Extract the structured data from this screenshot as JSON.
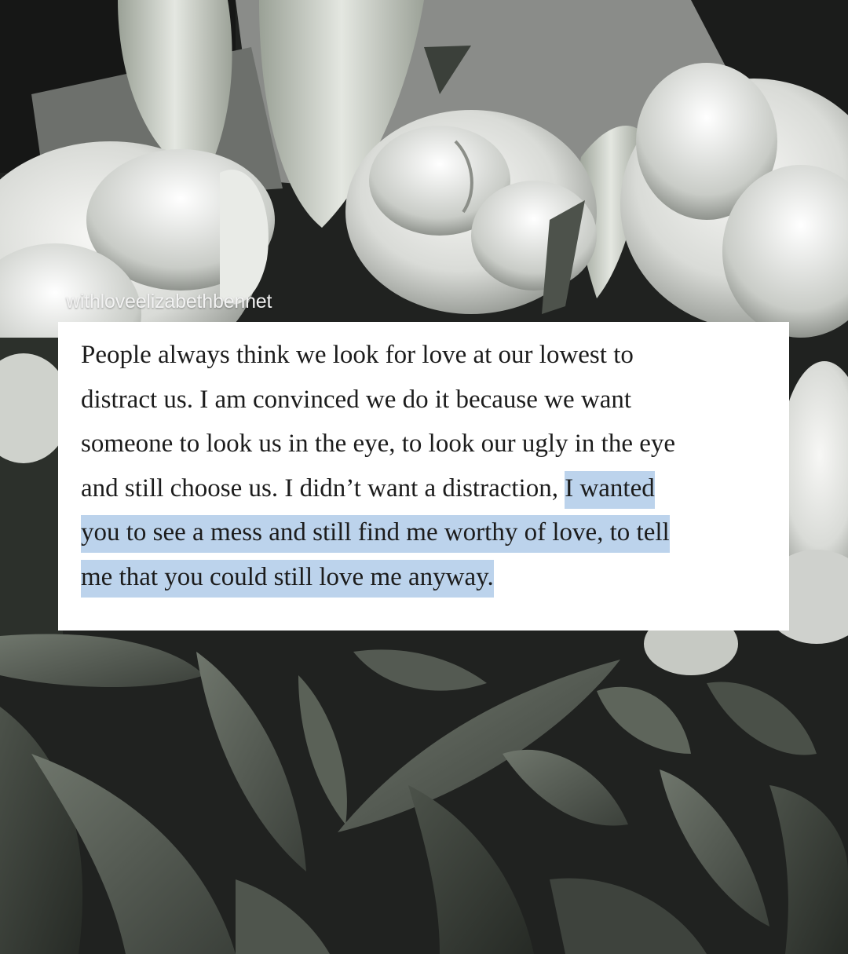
{
  "post": {
    "watermark": "withloveelizabethbennet",
    "quote_lines": [
      "People always think we look for love at our lowest to",
      "distract us. I am convinced we do it because we want",
      "someone to look us in the eye, to look our ugly in the eye",
      "and still choose us. I didn’t want a distraction,"
    ],
    "highlighted_lines": [
      "I wanted",
      "you to see a mess and still find me worthy of love, to tell",
      "me that you could still love me anyway."
    ],
    "highlight_color": "#bcd3ec",
    "card_color": "#ffffff",
    "background": "black and white photograph of white peonies and lilies with eucalyptus leaves"
  }
}
